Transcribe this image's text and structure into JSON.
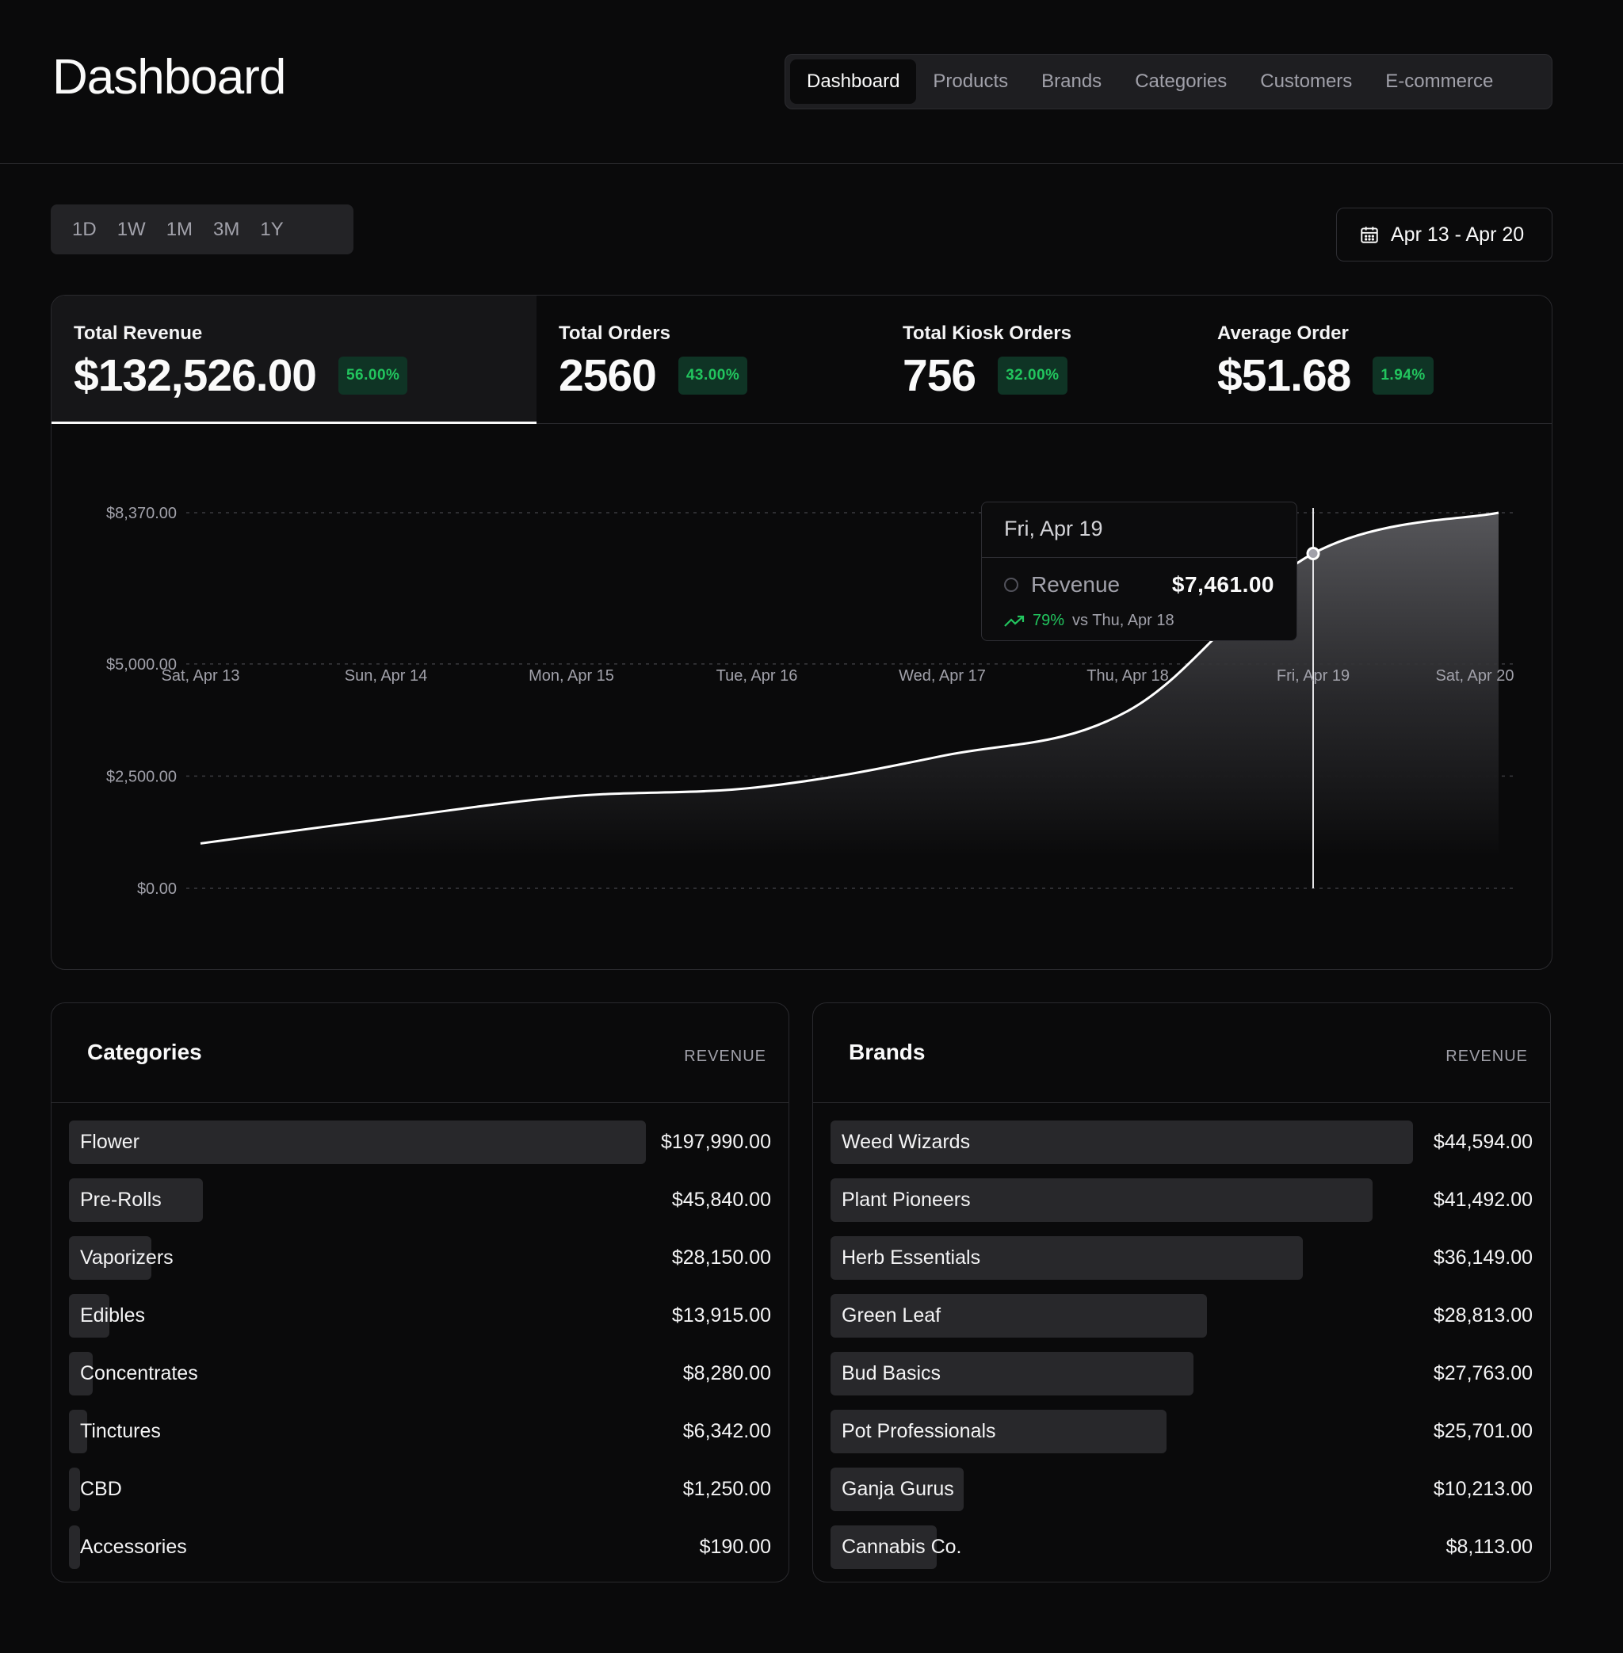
{
  "header": {
    "title": "Dashboard",
    "nav": [
      "Dashboard",
      "Products",
      "Brands",
      "Categories",
      "Customers",
      "E-commerce"
    ],
    "active_nav": "Dashboard"
  },
  "range_tabs": [
    "1D",
    "1W",
    "1M",
    "3M",
    "1Y"
  ],
  "date_range": {
    "label": "Apr 13 - Apr 20",
    "icon": "calendar-icon"
  },
  "kpis": [
    {
      "label": "Total Revenue",
      "value": "$132,526.00",
      "change": "56.00%",
      "active": true
    },
    {
      "label": "Total Orders",
      "value": "2560",
      "change": "43.00%",
      "active": false
    },
    {
      "label": "Total Kiosk Orders",
      "value": "756",
      "change": "32.00%",
      "active": false
    },
    {
      "label": "Average Order",
      "value": "$51.68",
      "change": "1.94%",
      "active": false
    }
  ],
  "colors": {
    "positive": "#22c55e",
    "badge_bg": "#0f3425",
    "line": "#ffffff"
  },
  "chart_data": {
    "type": "area",
    "categories": [
      "Sat, Apr 13",
      "Sun, Apr 14",
      "Mon, Apr 15",
      "Tue, Apr 16",
      "Wed, Apr 17",
      "Thu, Apr 18",
      "Fri, Apr 19",
      "Sat, Apr 20"
    ],
    "series": [
      {
        "values": [
          1000,
          1550,
          2050,
          2250,
          2950,
          3950,
          7461,
          8370
        ]
      }
    ],
    "y_ticks": [
      0,
      2500,
      5000,
      8370
    ],
    "y_tick_labels": [
      "$0.00",
      "$2,500.00",
      "$5,000.00",
      "$8,370.00"
    ],
    "ylim": [
      0,
      8370
    ],
    "grid": true,
    "tooltip": {
      "date": "Fri, Apr 19",
      "series_label": "Revenue",
      "value": "$7,461.00",
      "change_pct": "79%",
      "change_text": "vs Thu, Apr 18",
      "index": 6
    }
  },
  "categories_card": {
    "title": "Categories",
    "column": "REVENUE",
    "items": [
      {
        "label": "Flower",
        "value": "$197,990.00",
        "amount": 197990
      },
      {
        "label": "Pre-Rolls",
        "value": "$45,840.00",
        "amount": 45840
      },
      {
        "label": "Vaporizers",
        "value": "$28,150.00",
        "amount": 28150
      },
      {
        "label": "Edibles",
        "value": "$13,915.00",
        "amount": 13915
      },
      {
        "label": "Concentrates",
        "value": "$8,280.00",
        "amount": 8280
      },
      {
        "label": "Tinctures",
        "value": "$6,342.00",
        "amount": 6342
      },
      {
        "label": "CBD",
        "value": "$1,250.00",
        "amount": 1250
      },
      {
        "label": "Accessories",
        "value": "$190.00",
        "amount": 190
      }
    ]
  },
  "brands_card": {
    "title": "Brands",
    "column": "REVENUE",
    "items": [
      {
        "label": "Weed Wizards",
        "value": "$44,594.00",
        "amount": 44594
      },
      {
        "label": "Plant Pioneers",
        "value": "$41,492.00",
        "amount": 41492
      },
      {
        "label": "Herb Essentials",
        "value": "$36,149.00",
        "amount": 36149
      },
      {
        "label": "Green Leaf",
        "value": "$28,813.00",
        "amount": 28813
      },
      {
        "label": "Bud Basics",
        "value": "$27,763.00",
        "amount": 27763
      },
      {
        "label": "Pot Professionals",
        "value": "$25,701.00",
        "amount": 25701
      },
      {
        "label": "Ganja Gurus",
        "value": "$10,213.00",
        "amount": 10213
      },
      {
        "label": "Cannabis Co.",
        "value": "$8,113.00",
        "amount": 8113
      }
    ]
  }
}
